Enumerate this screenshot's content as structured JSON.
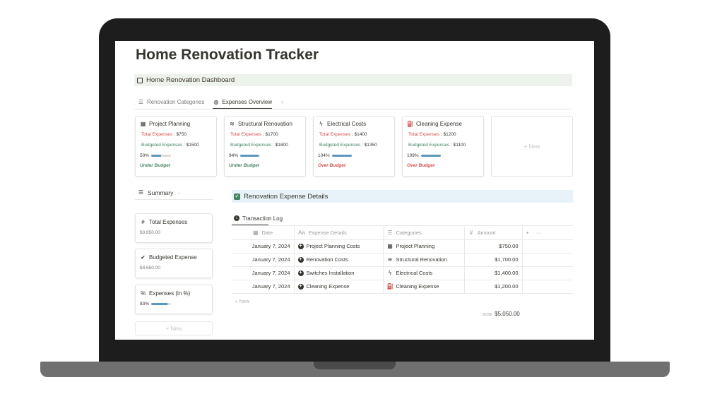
{
  "page": {
    "title": "Home Renovation Tracker"
  },
  "dashboard": {
    "label": "Home Renovation Dashboard"
  },
  "tabs": [
    {
      "label": "Renovation Categories",
      "icon": "list-icon"
    },
    {
      "label": "Expenses Overview",
      "icon": "compass-icon"
    }
  ],
  "cards": [
    {
      "title": "Project Planning",
      "icon": "calendar-icon",
      "total_label": "Total Expenses",
      "total": "$750",
      "budget_label": "Budgeted Expenses",
      "budget": "$1500",
      "percent": "50%",
      "progress": 0.5,
      "status": "Under Budget",
      "status_color": "#448361"
    },
    {
      "title": "Structural Renovation",
      "icon": "layers-icon",
      "total_label": "Total Expenses",
      "total": "$1700",
      "budget_label": "Budgeted Expenses",
      "budget": "$1800",
      "percent": "94%",
      "progress": 0.94,
      "status": "Under Budget",
      "status_color": "#448361"
    },
    {
      "title": "Electrical Costs",
      "icon": "lightning-icon",
      "total_label": "Total Expenses",
      "total": "$1400",
      "budget_label": "Budgeted Expenses",
      "budget": "$1350",
      "percent": "104%",
      "progress": 1.0,
      "status": "Over Budget",
      "status_color": "#d44c47"
    },
    {
      "title": "Cleaning Expense",
      "icon": "spray-icon",
      "total_label": "Total Expenses",
      "total": "$1200",
      "budget_label": "Budgeted Expenses",
      "budget": "$1100",
      "percent": "109%",
      "progress": 1.0,
      "status": "Over Budget",
      "status_color": "#d44c47"
    }
  ],
  "cards_new_label": "+ New",
  "summary": {
    "header": "Summary",
    "items": [
      {
        "title": "Total Expenses",
        "icon": "hash-icon",
        "value": "$3,850.00"
      },
      {
        "title": "Budgeted Expense",
        "icon": "check-circle-icon",
        "value": "$4,650.00"
      },
      {
        "title": "Expenses (in %)",
        "icon": "percent-icon",
        "value": "83%",
        "progress": 0.83
      }
    ],
    "new_label": "+ New"
  },
  "details": {
    "title": "Renovation Expense Details",
    "tab": "Transaction Log",
    "columns": [
      "Date",
      "Expense Details",
      "Categories",
      "Amount"
    ],
    "rows": [
      {
        "date": "January 7, 2024",
        "expense": "Project Planning Costs",
        "category": "Project Planning",
        "category_icon": "calendar-icon",
        "amount": "$750.00"
      },
      {
        "date": "January 7, 2024",
        "expense": "Renovation Costs",
        "category": "Structural Renovation",
        "category_icon": "layers-icon",
        "amount": "$1,700.00"
      },
      {
        "date": "January 7, 2024",
        "expense": "Switches Installation",
        "category": "Electrical Costs",
        "category_icon": "lightning-icon",
        "amount": "$1,400.00"
      },
      {
        "date": "January 7, 2024",
        "expense": "Cleaning Expense",
        "category": "Cleaning Expense",
        "category_icon": "spray-icon",
        "amount": "$1,200.00"
      }
    ],
    "new_label": "+ New",
    "sum_label": "SUM",
    "sum_value": "$5,050.00"
  },
  "colors": {
    "red": "#d44c47",
    "green": "#448361",
    "progress": "#5b97bd",
    "dashboard_bg": "#edf3ec",
    "details_bg": "#e7f3f8"
  }
}
